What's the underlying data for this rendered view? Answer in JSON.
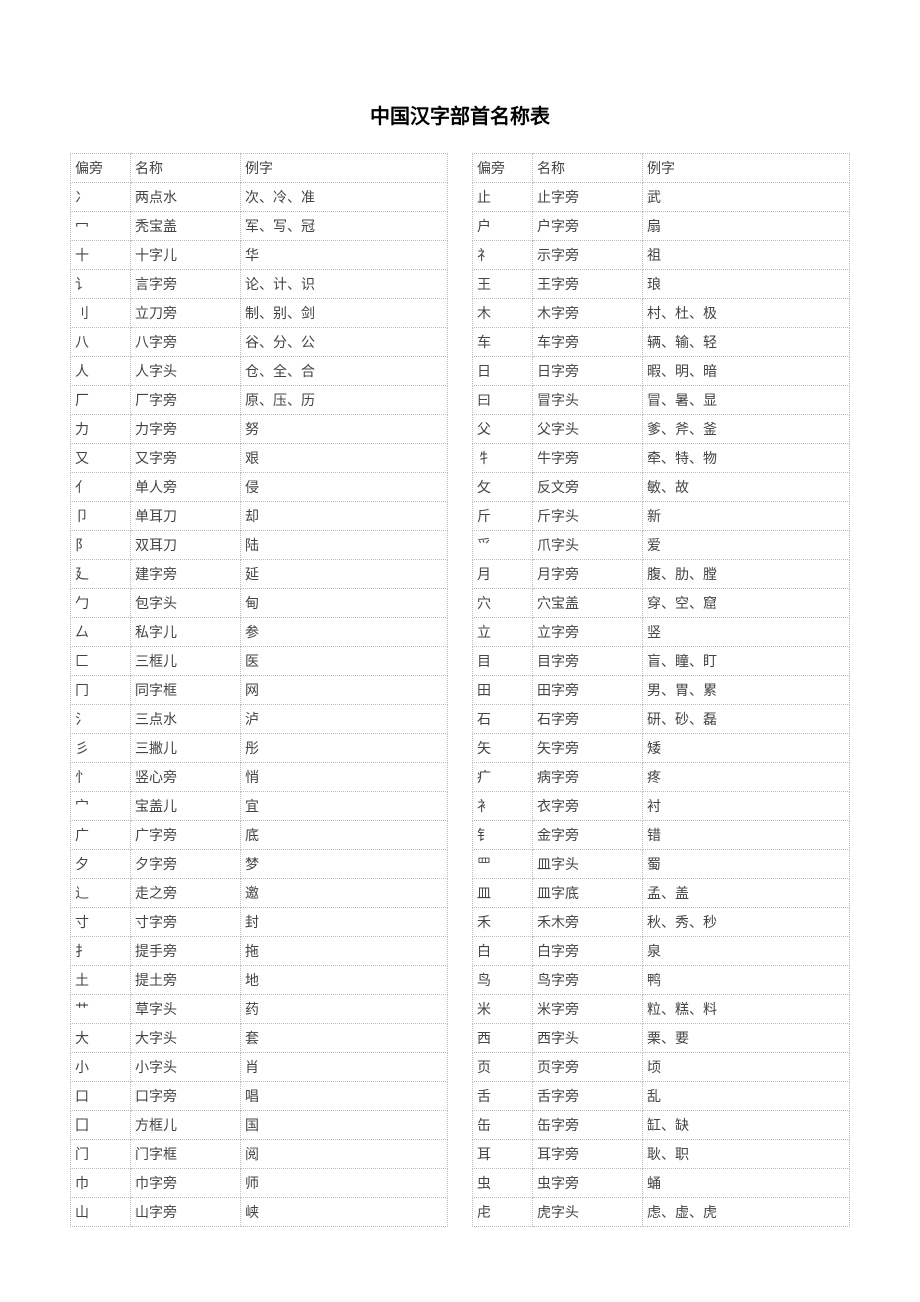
{
  "title": "中国汉字部首名称表",
  "headers": {
    "radical": "偏旁",
    "name": "名称",
    "example": "例字"
  },
  "left": [
    {
      "r": "冫",
      "n": "两点水",
      "e": "次、冷、准"
    },
    {
      "r": "冖",
      "n": "秃宝盖",
      "e": "军、写、冠"
    },
    {
      "r": "十",
      "n": "十字儿",
      "e": "华"
    },
    {
      "r": "讠",
      "n": "言字旁",
      "e": "论、计、识"
    },
    {
      "r": "刂",
      "n": "立刀旁",
      "e": "制、别、剑"
    },
    {
      "r": "八",
      "n": "八字旁",
      "e": "谷、分、公"
    },
    {
      "r": "人",
      "n": "人字头",
      "e": "仓、全、合"
    },
    {
      "r": "厂",
      "n": "厂字旁",
      "e": "原、压、历"
    },
    {
      "r": "力",
      "n": "力字旁",
      "e": "努"
    },
    {
      "r": "又",
      "n": "又字旁",
      "e": "艰"
    },
    {
      "r": "亻",
      "n": "单人旁",
      "e": "侵"
    },
    {
      "r": "卩",
      "n": "单耳刀",
      "e": "却"
    },
    {
      "r": "阝",
      "n": "双耳刀",
      "e": "陆"
    },
    {
      "r": "廴",
      "n": "建字旁",
      "e": "延"
    },
    {
      "r": "勹",
      "n": "包字头",
      "e": "甸"
    },
    {
      "r": "厶",
      "n": "私字儿",
      "e": "参"
    },
    {
      "r": "匚",
      "n": "三框儿",
      "e": "医"
    },
    {
      "r": "冂",
      "n": "同字框",
      "e": "网"
    },
    {
      "r": "氵",
      "n": "三点水",
      "e": "泸"
    },
    {
      "r": "彡",
      "n": "三撇儿",
      "e": "彤"
    },
    {
      "r": "忄",
      "n": "竖心旁",
      "e": "悄"
    },
    {
      "r": "宀",
      "n": "宝盖儿",
      "e": "宜"
    },
    {
      "r": "广",
      "n": "广字旁",
      "e": "底"
    },
    {
      "r": "夕",
      "n": "夕字旁",
      "e": "梦"
    },
    {
      "r": "辶",
      "n": "走之旁",
      "e": "邀"
    },
    {
      "r": "寸",
      "n": "寸字旁",
      "e": "封"
    },
    {
      "r": "扌",
      "n": "提手旁",
      "e": "拖"
    },
    {
      "r": "土",
      "n": "提土旁",
      "e": "地"
    },
    {
      "r": "艹",
      "n": "草字头",
      "e": "药"
    },
    {
      "r": "大",
      "n": "大字头",
      "e": "套"
    },
    {
      "r": "小",
      "n": "小字头",
      "e": "肖"
    },
    {
      "r": "口",
      "n": "口字旁",
      "e": "唱"
    },
    {
      "r": "囗",
      "n": "方框儿",
      "e": "国"
    },
    {
      "r": "门",
      "n": "门字框",
      "e": "阅"
    },
    {
      "r": "巾",
      "n": "巾字旁",
      "e": "师"
    },
    {
      "r": "山",
      "n": "山字旁",
      "e": "峡"
    }
  ],
  "right": [
    {
      "r": "止",
      "n": "止字旁",
      "e": "武"
    },
    {
      "r": "户",
      "n": "户字旁",
      "e": "扇"
    },
    {
      "r": "礻",
      "n": "示字旁",
      "e": "祖"
    },
    {
      "r": "王",
      "n": "王字旁",
      "e": "琅"
    },
    {
      "r": "木",
      "n": "木字旁",
      "e": "村、杜、极"
    },
    {
      "r": "车",
      "n": "车字旁",
      "e": "辆、输、轻"
    },
    {
      "r": "日",
      "n": "日字旁",
      "e": "暇、明、暗"
    },
    {
      "r": "曰",
      "n": "冒字头",
      "e": "冒、暑、显"
    },
    {
      "r": "父",
      "n": "父字头",
      "e": "爹、斧、釜"
    },
    {
      "r": "牜",
      "n": "牛字旁",
      "e": "牵、特、物"
    },
    {
      "r": "攵",
      "n": "反文旁",
      "e": "敏、故"
    },
    {
      "r": "斤",
      "n": "斤字头",
      "e": "新"
    },
    {
      "r": "爫",
      "n": "爪字头",
      "e": "爱"
    },
    {
      "r": "月",
      "n": "月字旁",
      "e": "腹、肋、膛"
    },
    {
      "r": "穴",
      "n": "穴宝盖",
      "e": "穿、空、窟"
    },
    {
      "r": "立",
      "n": "立字旁",
      "e": "竖"
    },
    {
      "r": "目",
      "n": "目字旁",
      "e": "盲、瞳、盯"
    },
    {
      "r": "田",
      "n": "田字旁",
      "e": "男、胃、累"
    },
    {
      "r": "石",
      "n": "石字旁",
      "e": "研、砂、磊"
    },
    {
      "r": "矢",
      "n": "矢字旁",
      "e": "矮"
    },
    {
      "r": "疒",
      "n": "病字旁",
      "e": "疼"
    },
    {
      "r": "衤",
      "n": "衣字旁",
      "e": "衬"
    },
    {
      "r": "钅",
      "n": "金字旁",
      "e": "错"
    },
    {
      "r": "罒",
      "n": "皿字头",
      "e": "蜀"
    },
    {
      "r": "皿",
      "n": "皿字底",
      "e": "孟、盖"
    },
    {
      "r": "禾",
      "n": "禾木旁",
      "e": "秋、秀、秒"
    },
    {
      "r": "白",
      "n": "白字旁",
      "e": "泉"
    },
    {
      "r": "鸟",
      "n": "鸟字旁",
      "e": "鸭"
    },
    {
      "r": "米",
      "n": "米字旁",
      "e": "粒、糕、料"
    },
    {
      "r": "西",
      "n": "西字头",
      "e": "栗、要"
    },
    {
      "r": "页",
      "n": "页字旁",
      "e": "顷"
    },
    {
      "r": "舌",
      "n": "舌字旁",
      "e": "乱"
    },
    {
      "r": "缶",
      "n": "缶字旁",
      "e": "缸、缺"
    },
    {
      "r": "耳",
      "n": "耳字旁",
      "e": "耿、职"
    },
    {
      "r": "虫",
      "n": "虫字旁",
      "e": "蛹"
    },
    {
      "r": "虍",
      "n": "虎字头",
      "e": "虑、虚、虎"
    }
  ]
}
